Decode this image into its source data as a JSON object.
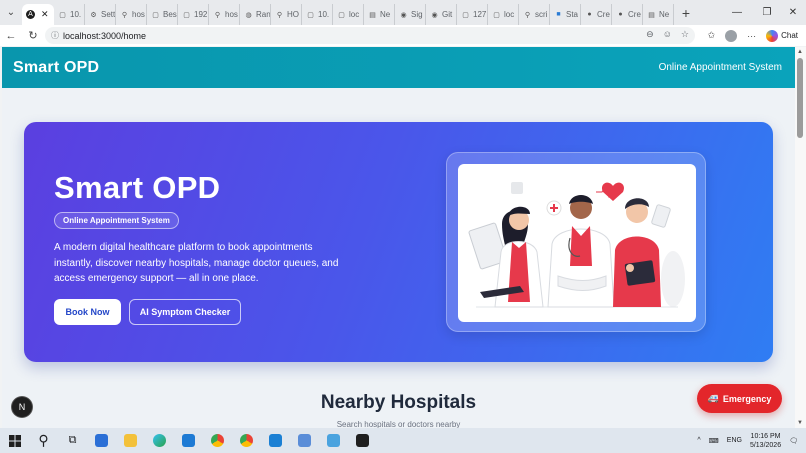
{
  "browser": {
    "tabs": [
      {
        "label": "",
        "icon": "circle-a-icon",
        "active": true
      },
      {
        "label": "10.",
        "icon": "page-icon"
      },
      {
        "label": "Sett",
        "icon": "gear-icon"
      },
      {
        "label": "hos",
        "icon": "search-icon"
      },
      {
        "label": "Bes",
        "icon": "page-icon"
      },
      {
        "label": "192",
        "icon": "page-icon"
      },
      {
        "label": "hos",
        "icon": "search-icon"
      },
      {
        "label": "Ran",
        "icon": "globe-icon"
      },
      {
        "label": "HO",
        "icon": "search-icon"
      },
      {
        "label": "10.",
        "icon": "page-icon"
      },
      {
        "label": "loc",
        "icon": "page-icon"
      },
      {
        "label": "Ne",
        "icon": "newtab-icon"
      },
      {
        "label": "Sig",
        "icon": "github-icon"
      },
      {
        "label": "Git",
        "icon": "github-icon"
      },
      {
        "label": "127",
        "icon": "page-icon"
      },
      {
        "label": "loc",
        "icon": "page-icon"
      },
      {
        "label": "scri",
        "icon": "search-icon"
      },
      {
        "label": "Sta",
        "icon": "blue-square-icon"
      },
      {
        "label": "Cre",
        "icon": "circle-icon"
      },
      {
        "label": "Cre",
        "icon": "circle-icon"
      },
      {
        "label": "Ne",
        "icon": "newtab-icon"
      }
    ],
    "url": "localhost:3000/home",
    "chat_label": "Chat"
  },
  "app": {
    "brand": "Smart OPD",
    "header_subtitle": "Online Appointment System"
  },
  "hero": {
    "title": "Smart OPD",
    "badge": "Online Appointment System",
    "description": "A modern digital healthcare platform to book appointments instantly, discover nearby hospitals, manage doctor queues, and access emergency support — all in one place.",
    "primary_button": "Book Now",
    "secondary_button": "AI Symptom Checker"
  },
  "section": {
    "title": "Nearby Hospitals",
    "subtitle": "Search hospitals or doctors nearby"
  },
  "floating": {
    "emergency_label": "Emergency",
    "next_badge": "N"
  },
  "taskbar": {
    "language": "ENG",
    "time": "10:16 PM",
    "date": "5/13/2026"
  },
  "colors": {
    "header": "#0aa3bb",
    "hero_start": "#5b3fe0",
    "hero_end": "#2f7df3",
    "emergency": "#e3262b"
  }
}
